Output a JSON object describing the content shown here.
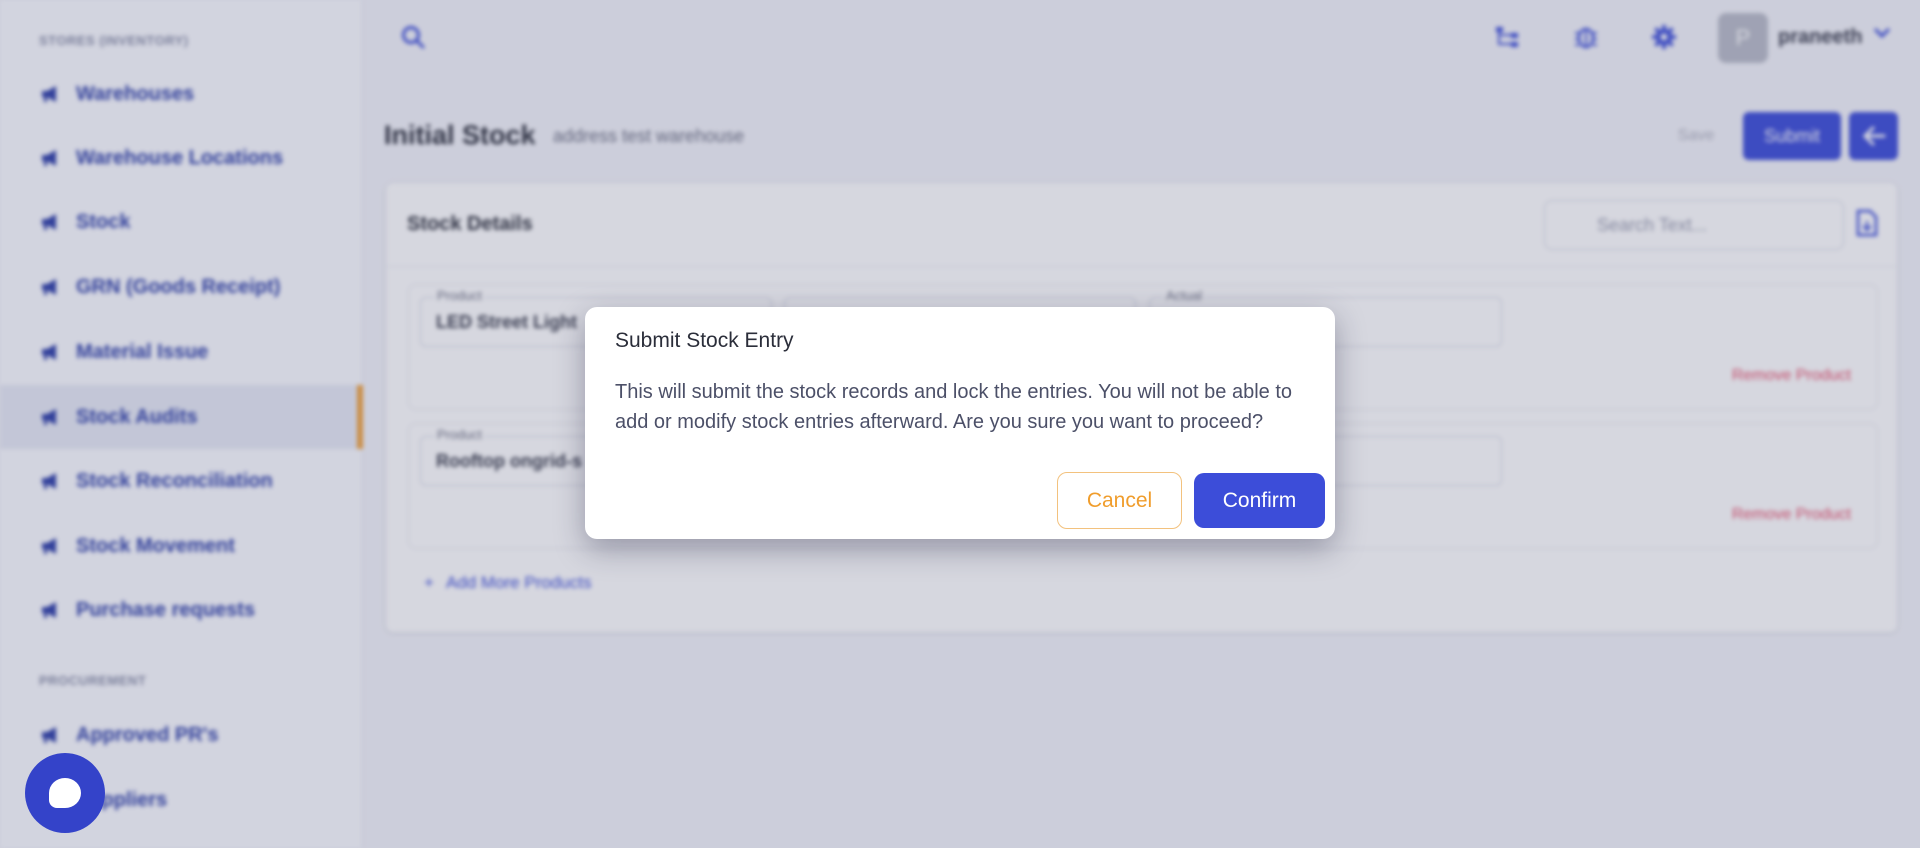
{
  "sidebar": {
    "section_inventory": "STORES (INVENTORY)",
    "section_procurement": "PROCUREMENT",
    "items": [
      {
        "label": "Warehouses",
        "icon": "megaphone-icon"
      },
      {
        "label": "Warehouse Locations",
        "icon": "megaphone-icon"
      },
      {
        "label": "Stock",
        "icon": "megaphone-icon"
      },
      {
        "label": "GRN (Goods Receipt)",
        "icon": "megaphone-icon"
      },
      {
        "label": "Material Issue",
        "icon": "megaphone-icon"
      },
      {
        "label": "Stock Audits",
        "icon": "megaphone-icon",
        "active": true
      },
      {
        "label": "Stock Reconciliation",
        "icon": "megaphone-icon"
      },
      {
        "label": "Stock Movement",
        "icon": "megaphone-icon"
      },
      {
        "label": "Purchase requests",
        "icon": "megaphone-icon"
      }
    ],
    "procurement_items": [
      {
        "label": "Approved PR's",
        "icon": "megaphone-icon"
      },
      {
        "label": "Suppliers",
        "icon": "megaphone-icon"
      }
    ]
  },
  "topbar": {
    "icons": [
      "search-icon",
      "hierarchy-icon",
      "bug-icon",
      "gear-icon"
    ],
    "avatar_initial": "P",
    "user_name": "praneeth"
  },
  "page": {
    "title": "Initial Stock",
    "subtitle": "address test warehouse",
    "save_label": "Save",
    "submit_label": "Submit"
  },
  "card": {
    "title": "Stock Details",
    "search_placeholder": "Search Text...",
    "rows": [
      {
        "product_label": "Product",
        "product_value": "LED Street Light",
        "actual_label": "Actual",
        "remove_label": "Remove Product"
      },
      {
        "product_label": "Product",
        "product_value": "Rooftop ongrid-s",
        "actual_label": "",
        "remove_label": "Remove Product"
      }
    ],
    "add_more_label": "Add More Products"
  },
  "modal": {
    "title": "Submit Stock Entry",
    "body": "This will submit the stock records and lock the entries. You will not be able to add or modify stock entries afterward. Are you sure you want to proceed?",
    "cancel_label": "Cancel",
    "confirm_label": "Confirm"
  },
  "colors": {
    "primary": "#3c4dd9",
    "accent": "#f09d2c",
    "danger": "#e84c6a"
  }
}
